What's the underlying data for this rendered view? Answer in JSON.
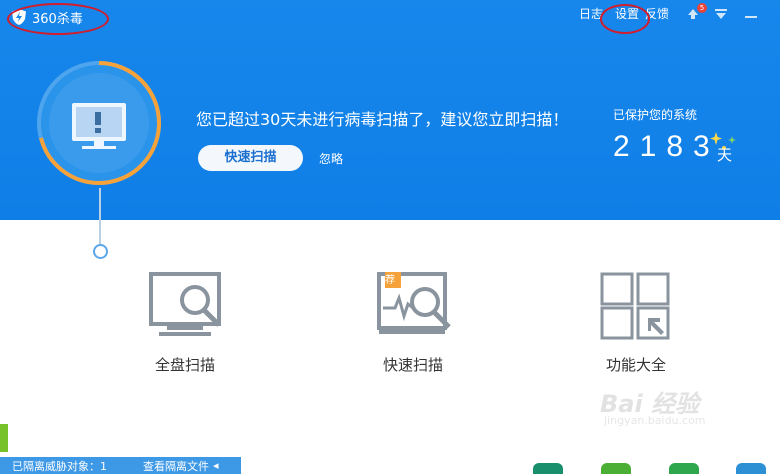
{
  "header": {
    "app_title": "360杀毒",
    "links": [
      "日志",
      "设置",
      "反馈"
    ],
    "update_badge": "5"
  },
  "status": {
    "message": "您已超过30天未进行病毒扫描了，建议您立即扫描！",
    "quick_scan_label": "快速扫描",
    "ignore_label": "忽略",
    "protected_label": "已保护您的系统",
    "protected_days": "2183",
    "days_unit": "天"
  },
  "features": [
    {
      "label": "全盘扫描",
      "icon": "full-scan-icon"
    },
    {
      "label": "快速扫描",
      "icon": "quick-scan-icon",
      "tag": "荐"
    },
    {
      "label": "功能大全",
      "icon": "tools-grid-icon"
    }
  ],
  "footer": {
    "quarantine_label": "已隔离威胁对象：1",
    "view_quarantine_label": "查看隔离文件"
  },
  "watermark": {
    "brand": "Bai 经验",
    "url": "jingyan.baidu.com"
  },
  "colors": {
    "header_blue": "#1787ec",
    "annotation_red": "#d11d2c",
    "progress_orange": "#f6a23a",
    "icon_gray": "#8a949e"
  }
}
